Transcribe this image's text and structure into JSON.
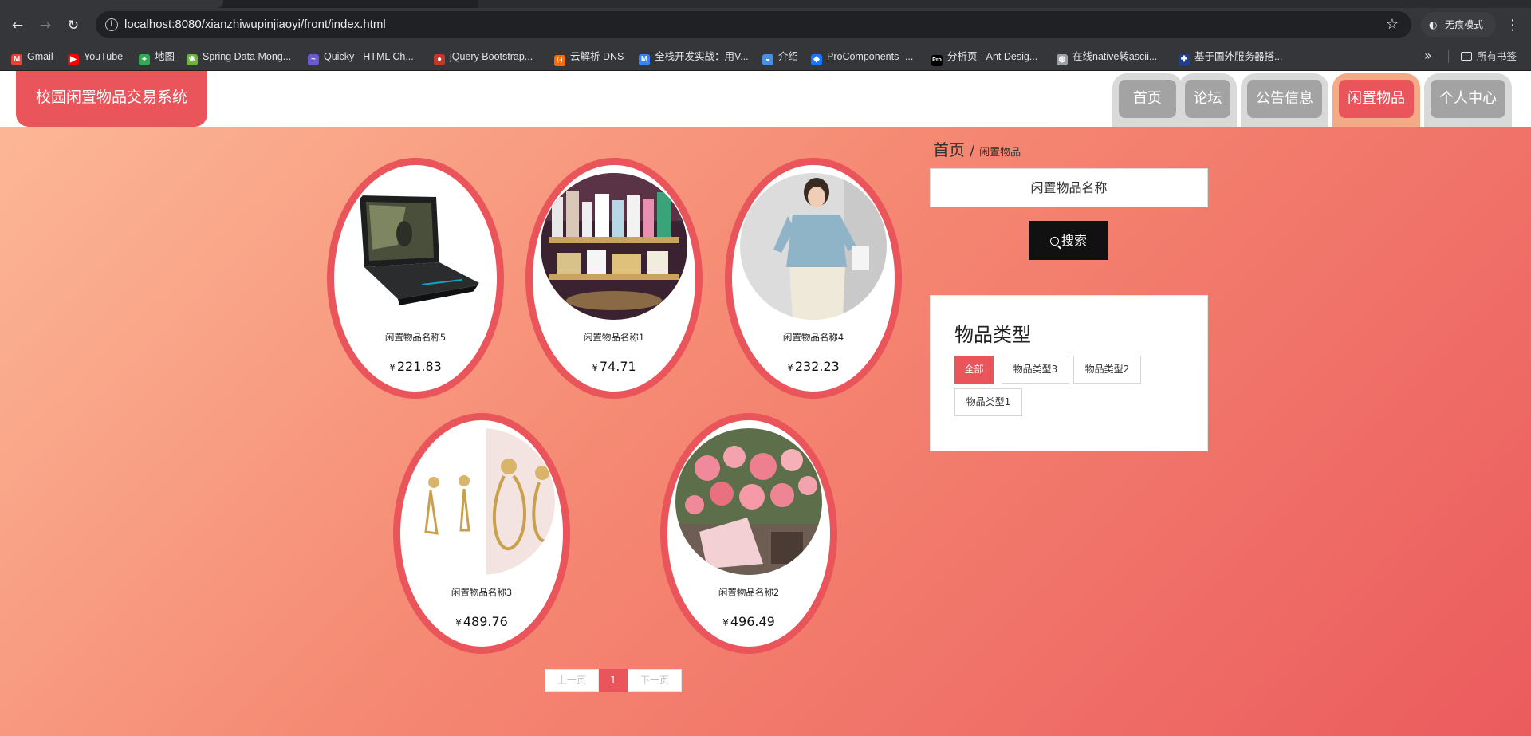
{
  "browser": {
    "url": "localhost:8080/xianzhiwupinjiaoyi/front/index.html",
    "incognito_label": "无痕模式",
    "bookmarks": [
      {
        "label": "Gmail",
        "icon": "gmail-icon",
        "color": "#ea4335"
      },
      {
        "label": "YouTube",
        "icon": "youtube-icon",
        "color": "#ff0000"
      },
      {
        "label": "地图",
        "icon": "maps-icon",
        "color": "#34a853"
      },
      {
        "label": "Spring Data Mong...",
        "icon": "spring-icon",
        "color": "#6db33f"
      },
      {
        "label": "Quicky - HTML Ch...",
        "icon": "quicky-icon",
        "color": "#6a5acd"
      },
      {
        "label": "jQuery Bootstrap...",
        "icon": "jquery-icon",
        "color": "#c0392b"
      },
      {
        "label": "云解析 DNS",
        "icon": "aliyun-icon",
        "color": "#ff6a00"
      },
      {
        "label": "全栈开发实战：用V...",
        "icon": "m-icon",
        "color": "#3b82f6"
      },
      {
        "label": "介绍",
        "icon": "globe-icon",
        "color": "#4a90e2"
      },
      {
        "label": "ProComponents -...",
        "icon": "antd-icon",
        "color": "#1677ff"
      },
      {
        "label": "分析页 - Ant Desig...",
        "icon": "pro-icon",
        "color": "#000000"
      },
      {
        "label": "在线native转ascii...",
        "icon": "web-icon",
        "color": "#9aa0a6"
      },
      {
        "label": "基于国外服务器搭...",
        "icon": "flag-icon",
        "color": "#1f3f8f"
      }
    ],
    "bookmarks_folder": "所有书签"
  },
  "site": {
    "title": "校园闲置物品交易系统",
    "nav": [
      {
        "label": "首页",
        "active": false
      },
      {
        "label": "论坛",
        "active": false
      },
      {
        "label": "公告信息",
        "active": false
      },
      {
        "label": "闲置物品",
        "active": true
      },
      {
        "label": "个人中心",
        "active": false
      }
    ]
  },
  "breadcrumb": {
    "home": "首页",
    "separator": "/",
    "current": "闲置物品"
  },
  "products": [
    {
      "name": "闲置物品名称5",
      "currency": "¥",
      "price": "221.83",
      "image": "laptop"
    },
    {
      "name": "闲置物品名称1",
      "currency": "¥",
      "price": "74.71",
      "image": "cosmetics-shelf"
    },
    {
      "name": "闲置物品名称4",
      "currency": "¥",
      "price": "232.23",
      "image": "blouse"
    },
    {
      "name": "闲置物品名称3",
      "currency": "¥",
      "price": "489.76",
      "image": "earrings"
    },
    {
      "name": "闲置物品名称2",
      "currency": "¥",
      "price": "496.49",
      "image": "flowers"
    }
  ],
  "pagination": {
    "prev": "上一页",
    "current": "1",
    "next": "下一页"
  },
  "search": {
    "placeholder": "闲置物品名称",
    "button": "搜索"
  },
  "categories": {
    "title": "物品类型",
    "items": [
      {
        "label": "全部",
        "active": true
      },
      {
        "label": "物品类型3",
        "active": false
      },
      {
        "label": "物品类型2",
        "active": false
      },
      {
        "label": "物品类型1",
        "active": false
      }
    ]
  },
  "colors": {
    "accent": "#e9555a",
    "nav_inactive": "#a3a3a3",
    "nav_active_frame": "#f4a987"
  }
}
